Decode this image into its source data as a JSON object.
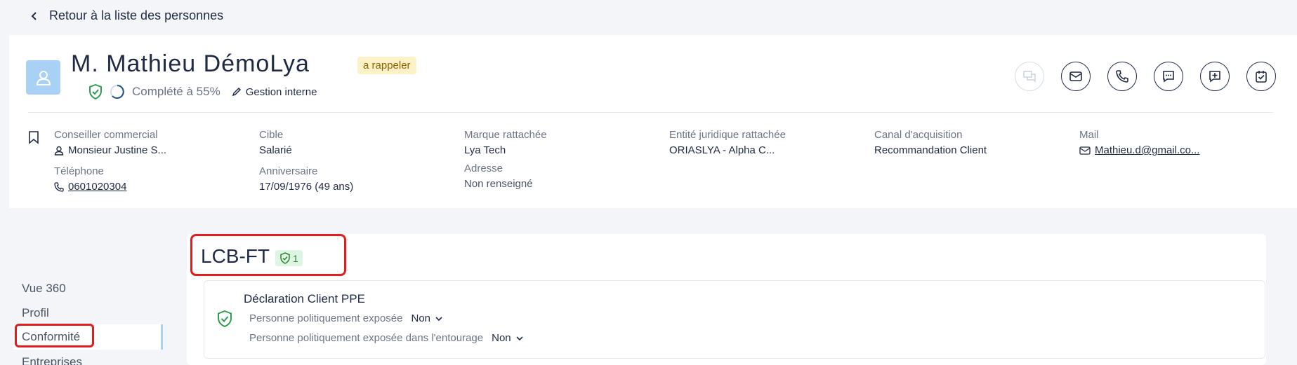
{
  "back_link": "Retour à la liste des personnes",
  "person": {
    "name": "M. Mathieu DémoLya",
    "tag": "a rappeler",
    "completion": "Complété à 55%",
    "management": "Gestion interne"
  },
  "fields": {
    "advisor": {
      "label": "Conseiller commercial",
      "value": "Monsieur Justine S..."
    },
    "phone": {
      "label": "Téléphone",
      "value": "0601020304"
    },
    "target": {
      "label": "Cible",
      "value": "Salarié"
    },
    "birthday": {
      "label": "Anniversaire",
      "value": "17/09/1976 (49 ans)"
    },
    "brand": {
      "label": "Marque rattachée",
      "value": "Lya Tech"
    },
    "address": {
      "label": "Adresse",
      "value": "Non renseigné"
    },
    "entity": {
      "label": "Entité juridique rattachée",
      "value": "ORIASLYA - Alpha C..."
    },
    "channel": {
      "label": "Canal d'acquisition",
      "value": "Recommandation Client"
    },
    "mail": {
      "label": "Mail",
      "value": "Mathieu.d@gmail.co..."
    }
  },
  "nav": [
    "Vue 360",
    "Profil",
    "Conformité",
    "Entreprises"
  ],
  "section": {
    "title": "LCB-FT",
    "badge_count": "1"
  },
  "declaration": {
    "title": "Déclaration Client PPE",
    "rows": [
      {
        "label": "Personne politiquement exposée",
        "value": "Non"
      },
      {
        "label": "Personne politiquement exposée dans l'entourage",
        "value": "Non"
      }
    ]
  },
  "colors": {
    "accent_blue": "#a9d0f5",
    "tag_bg": "#fdf1c7",
    "highlight_red": "#e11d1d",
    "success_green": "#2e7d32"
  }
}
